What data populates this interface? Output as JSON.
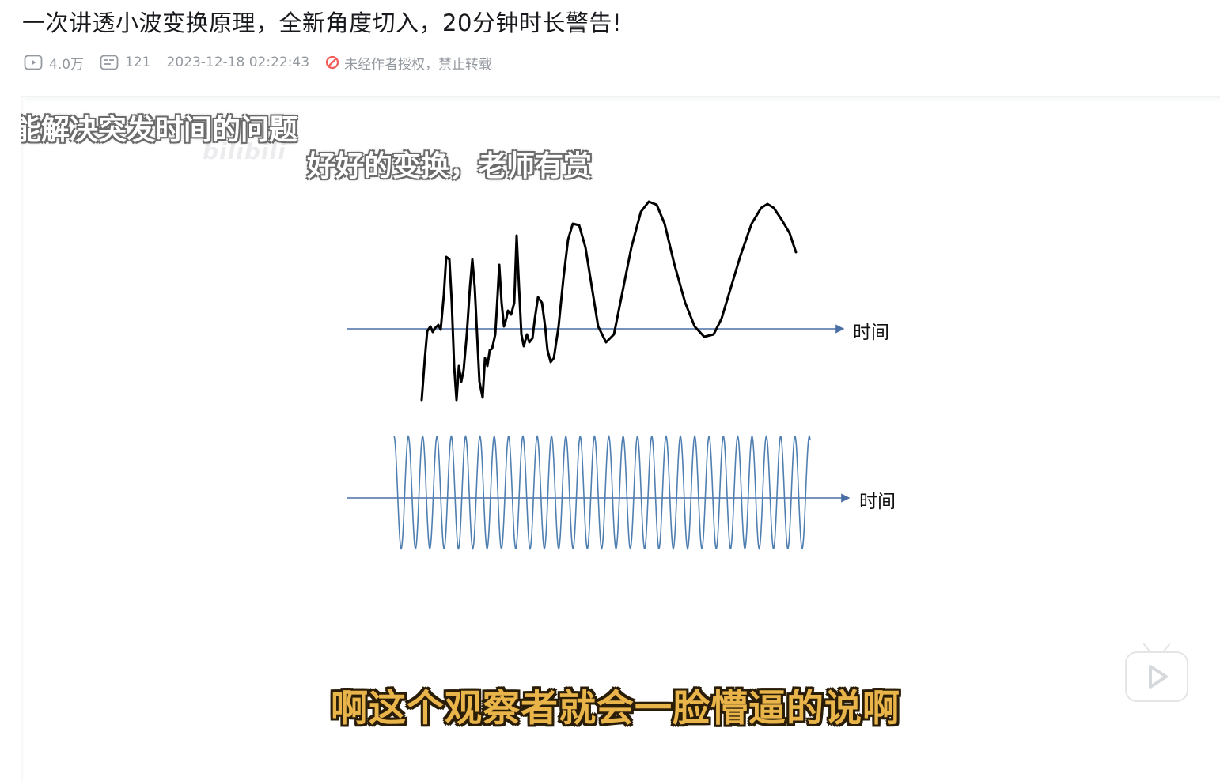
{
  "header": {
    "title": "一次讲透小波变换原理，全新角度切入，20分钟时长警告!"
  },
  "meta": {
    "views": "4.0万",
    "views_icon": "play-count-icon",
    "danmaku_count": "121",
    "danmaku_icon": "danmaku-icon",
    "publish_time": "2023-12-18 02:22:43",
    "copyright_notice": "未经作者授权，禁止转载",
    "copyright_icon": "no-repost-icon",
    "copyright_color": "#f25d59"
  },
  "player": {
    "danmaku": [
      "能解决突发时间的问题",
      "好好的变换，老师有赏"
    ],
    "watermark": "bilibili",
    "slide": {
      "axis_label_top": "时间",
      "axis_label_bottom": "时间",
      "axis_color": "#4a6fa5",
      "signal_color": "#000000",
      "wave_color": "#4f7fb0"
    },
    "subtitle": "啊这个观察者就会一脸懵逼的说啊",
    "subtitle_color": "#e9b54a",
    "play_button_icon": "bilibili-tv-play-icon"
  }
}
